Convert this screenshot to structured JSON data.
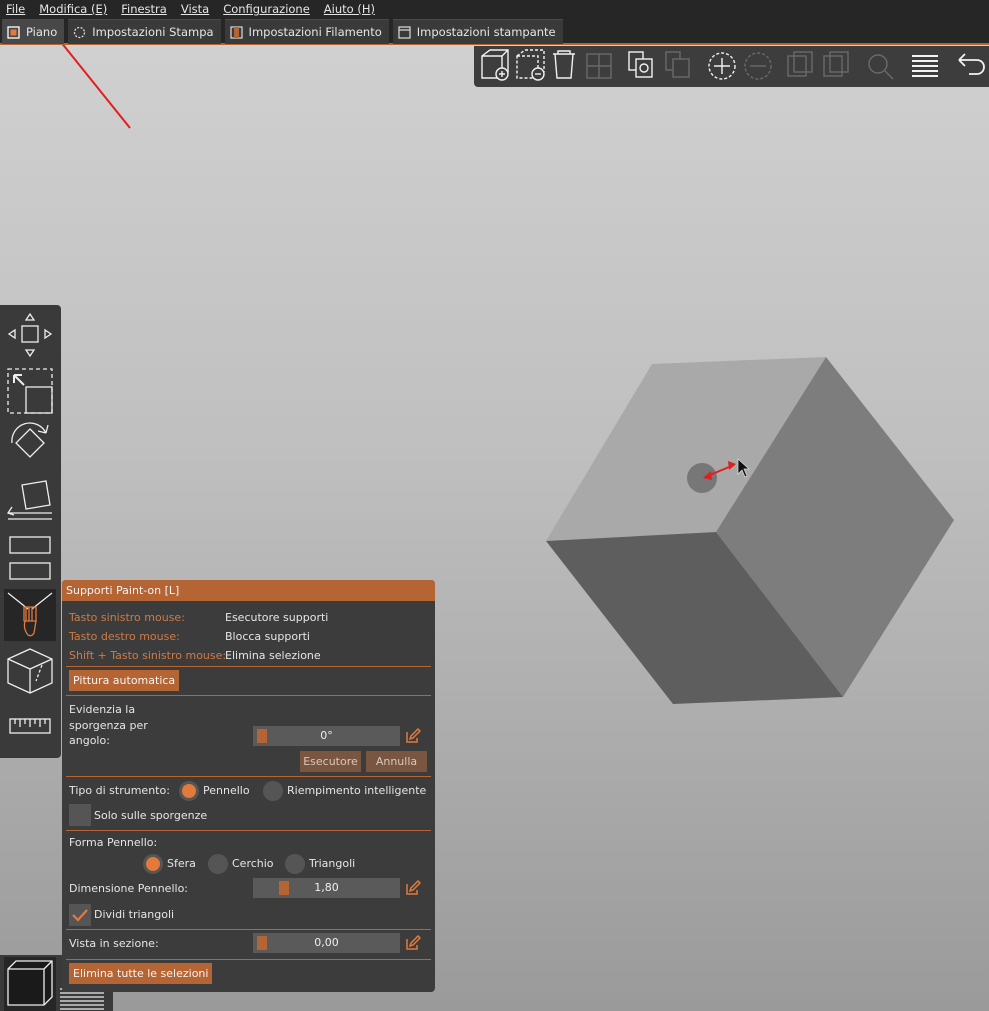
{
  "menubar": {
    "items": [
      "File",
      "Modifica (E)",
      "Finestra",
      "Vista",
      "Configurazione",
      "Aiuto (H)"
    ]
  },
  "tabs": [
    {
      "label": "Piano",
      "icon": "plate-icon",
      "active": true
    },
    {
      "label": "Impostazioni Stampa",
      "icon": "print-settings-icon"
    },
    {
      "label": "Impostazioni Filamento",
      "icon": "filament-icon"
    },
    {
      "label": "Impostazioni stampante",
      "icon": "printer-icon"
    }
  ],
  "toolbar": {
    "icons": [
      "add-object-icon",
      "delete-object-icon",
      "delete-all-icon",
      "arrange-icon",
      "copy-icon",
      "paste-icon",
      "add-instance-icon",
      "remove-instance-icon",
      "split-objects-icon",
      "split-parts-icon",
      "search-icon",
      "layers-icon",
      "undo-icon"
    ]
  },
  "left_toolbar": {
    "tools": [
      "move-icon",
      "scale-icon",
      "rotate-icon",
      "place-on-face-icon",
      "cut-icon",
      "paint-supports-icon",
      "seam-icon",
      "measure-icon"
    ],
    "active": "paint-supports-icon"
  },
  "view": {
    "buttons": [
      "3d-view-icon",
      "preview-layers-icon"
    ]
  },
  "panel": {
    "title": "Supporti Paint-on [L]",
    "hints": [
      {
        "key": "Tasto sinistro mouse:",
        "value": "Esecutore supporti"
      },
      {
        "key": "Tasto destro mouse:",
        "value": "Blocca supporti"
      },
      {
        "key": "Shift + Tasto sinistro mouse:",
        "value": "Elimina selezione"
      }
    ],
    "auto_paint_label": "Pittura automatica",
    "overhang_label_1": "Evidenzia la",
    "overhang_label_2": "sporgenza per",
    "overhang_label_3": "angolo:",
    "overhang_value": "0°",
    "overhang_fraction": 0.05,
    "enforce_label": "Esecutore",
    "cancel_label": "Annulla",
    "tool_type_label": "Tipo di strumento:",
    "tool_brush_label": "Pennello",
    "tool_smart_fill_label": "Riempimento intelligente",
    "overhang_only_label": "Solo sulle sporgenze",
    "brush_shape_label": "Forma Pennello:",
    "shape_sphere_label": "Sfera",
    "shape_circle_label": "Cerchio",
    "shape_triangles_label": "Triangoli",
    "brush_size_label": "Dimensione Pennello:",
    "brush_size_value": "1,80",
    "brush_size_fraction": 0.2,
    "split_triangles_label": "Dividi triangoli",
    "split_triangles_checked": true,
    "section_view_label": "Vista in sezione:",
    "section_view_value": "0,00",
    "section_view_fraction": 0.05,
    "clear_all_label": "Elimina tutte le selezioni"
  },
  "colors": {
    "accent": "#b56434",
    "radio_on": "#e37a3a",
    "annotation_arrow": "#e02020"
  }
}
